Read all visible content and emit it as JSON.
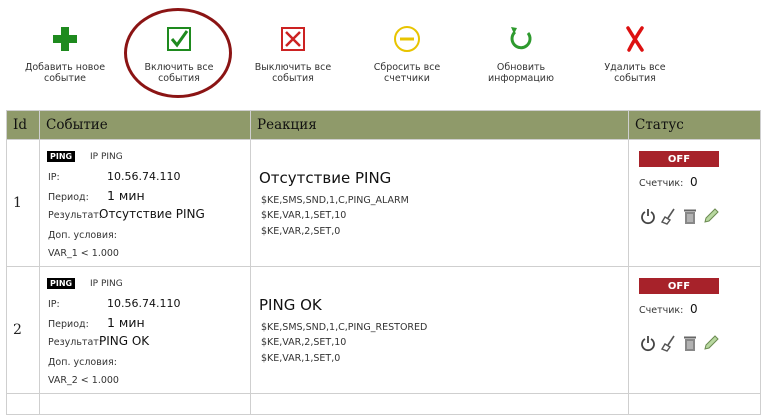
{
  "toolbar": [
    {
      "label": "Добавить новое\nсобытие",
      "icon": "plus-icon",
      "color": "#1e8a1e"
    },
    {
      "label": "Включить все\nсобытия",
      "icon": "checkbox-icon",
      "color": "#1e8a1e"
    },
    {
      "label": "Выключить все\nсобытия",
      "icon": "cross-box-icon",
      "color": "#cc2222"
    },
    {
      "label": "Сбросить все\nсчетчики",
      "icon": "minus-circle-icon",
      "color": "#e8c400"
    },
    {
      "label": "Обновить\nинформацию",
      "icon": "refresh-icon",
      "color": "#2e9a2e"
    },
    {
      "label": "Удалить все\nсобытия",
      "icon": "x-icon",
      "color": "#dd1111"
    }
  ],
  "table": {
    "headers": {
      "id": "Id",
      "event": "Событие",
      "reaction": "Реакция",
      "status": "Статус"
    },
    "rows": [
      {
        "id": "1",
        "badge": "PING",
        "type": "IP PING",
        "ip_label": "IP:",
        "ip": "10.56.74.110",
        "period_label": "Период:",
        "period": "1 мин",
        "result_label": "Результат:",
        "result": "Отсутствие PING",
        "cond_label": "Доп. условия:",
        "cond": "VAR_1 < 1.000",
        "reaction_title": "Отсутствие PING",
        "commands": [
          "$KE,SMS,SND,1,C,PING_ALARM",
          "$KE,VAR,1,SET,10",
          "$KE,VAR,2,SET,0"
        ],
        "status": "OFF",
        "counter_label": "Счетчик:",
        "counter": "0"
      },
      {
        "id": "2",
        "badge": "PING",
        "type": "IP PING",
        "ip_label": "IP:",
        "ip": "10.56.74.110",
        "period_label": "Период:",
        "period": "1 мин",
        "result_label": "Результат:",
        "result": "PING OK",
        "cond_label": "Доп. условия:",
        "cond": "VAR_2 < 1.000",
        "reaction_title": "PING OK",
        "commands": [
          "$KE,SMS,SND,1,C,PING_RESTORED",
          "$KE,VAR,2,SET,10",
          "$KE,VAR,1,SET,0"
        ],
        "status": "OFF",
        "counter_label": "Счетчик:",
        "counter": "0"
      }
    ]
  }
}
